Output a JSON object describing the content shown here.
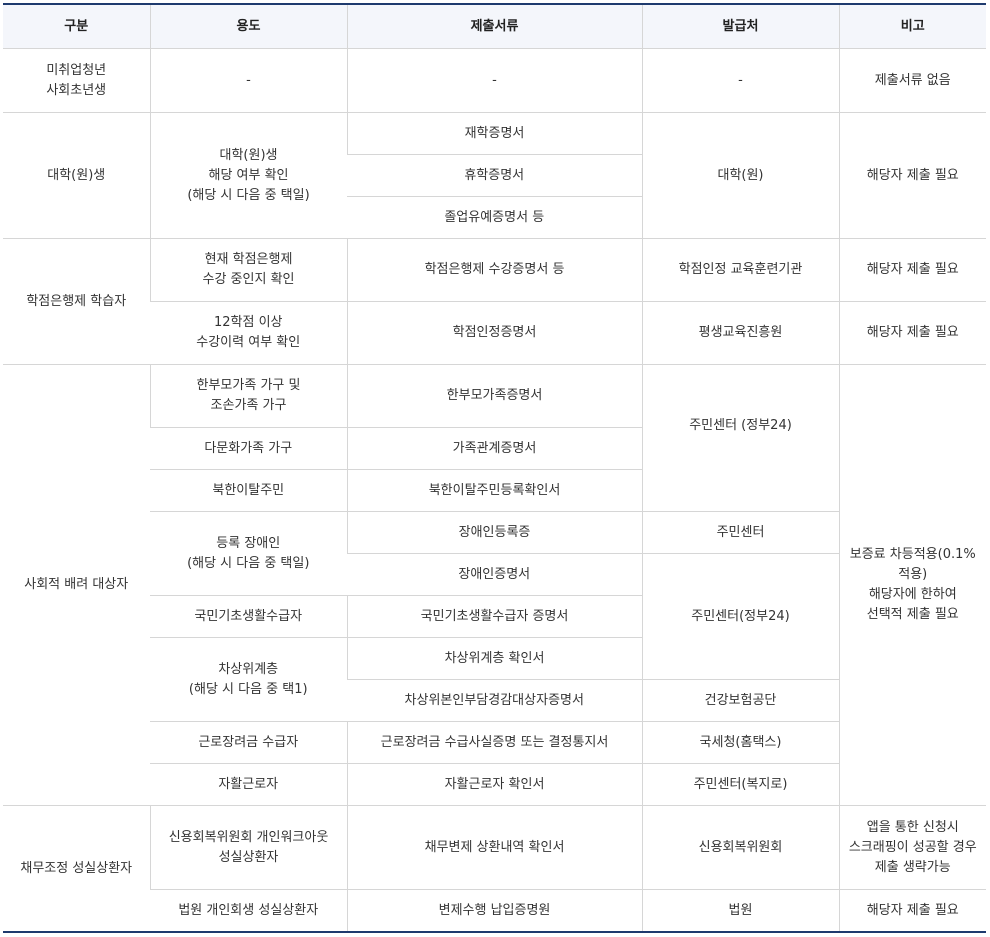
{
  "headers": {
    "category": "구분",
    "purpose": "용도",
    "documents": "제출서류",
    "issuer": "발급처",
    "note": "비고"
  },
  "rows": {
    "r1": {
      "category": [
        "미취업청년",
        "사회초년생"
      ],
      "purpose": "-",
      "document": "-",
      "issuer": "-",
      "note": "제출서류 없음"
    },
    "univ": {
      "category": "대학(원)생",
      "purpose": [
        "대학(원)생",
        "해당 여부 확인",
        "(해당 시 다음 중 택일)"
      ],
      "documents": [
        "재학증명서",
        "휴학증명서",
        "졸업유예증명서 등"
      ],
      "issuer": "대학(원)",
      "note": "해당자 제출 필요"
    },
    "credit": {
      "category": "학점은행제 학습자",
      "rows": [
        {
          "purpose": [
            "현재 학점은행제",
            "수강 중인지 확인"
          ],
          "document": "학점은행제 수강증명서 등",
          "issuer": "학점인정 교육훈련기관",
          "note": "해당자 제출 필요"
        },
        {
          "purpose": [
            "12학점 이상",
            "수강이력 여부 확인"
          ],
          "document": "학점인정증명서",
          "issuer": "평생교육진흥원",
          "note": "해당자 제출 필요"
        }
      ]
    },
    "social": {
      "category": "사회적 배려 대상자",
      "note": [
        "보증료 차등적용(0.1%",
        "적용)",
        "해당자에 한하여",
        "선택적 제출 필요"
      ],
      "single_parent": {
        "purpose": [
          "한부모가족 가구 및",
          "조손가족 가구"
        ],
        "document": "한부모가족증명서"
      },
      "multicultural": {
        "purpose": "다문화가족 가구",
        "document": "가족관계증명서"
      },
      "defector": {
        "purpose": "북한이탈주민",
        "document": "북한이탈주민등록확인서"
      },
      "issuer_gov24": "주민센터 (정부24)",
      "disabled": {
        "purpose": [
          "등록 장애인",
          "(해당 시 다음 중 택일)"
        ],
        "documents": [
          "장애인등록증",
          "장애인증명서"
        ],
        "issuer_card": "주민센터"
      },
      "basic_living": {
        "purpose": "국민기초생활수급자",
        "document": "국민기초생활수급자 증명서"
      },
      "issuer_gov24_b": "주민센터(정부24)",
      "near_poverty": {
        "purpose": [
          "차상위계층",
          "(해당 시 다음 중 택1)"
        ],
        "documents": [
          "차상위계층 확인서",
          "차상위본인부담경감대상자증명서"
        ],
        "issuer_health": "건강보험공단"
      },
      "eitc": {
        "purpose": "근로장려금 수급자",
        "document": "근로장려금 수급사실증명 또는 결정통지서",
        "issuer": "국세청(홈택스)"
      },
      "self_support": {
        "purpose": "자활근로자",
        "document": "자활근로자 확인서",
        "issuer": "주민센터(복지로)"
      }
    },
    "debt": {
      "category": "채무조정 성실상환자",
      "ccrs": {
        "purpose": [
          "신용회복위원회 개인워크아웃",
          "성실상환자"
        ],
        "document": "채무변제 상환내역 확인서",
        "issuer": "신용회복위원회",
        "note": [
          "앱을 통한 신청시",
          "스크래핑이 성공할 경우",
          "제출 생략가능"
        ]
      },
      "court": {
        "purpose": "법원 개인회생 성실상환자",
        "document": "변제수행 납입증명원",
        "issuer": "법원",
        "note": "해당자 제출 필요"
      }
    }
  }
}
